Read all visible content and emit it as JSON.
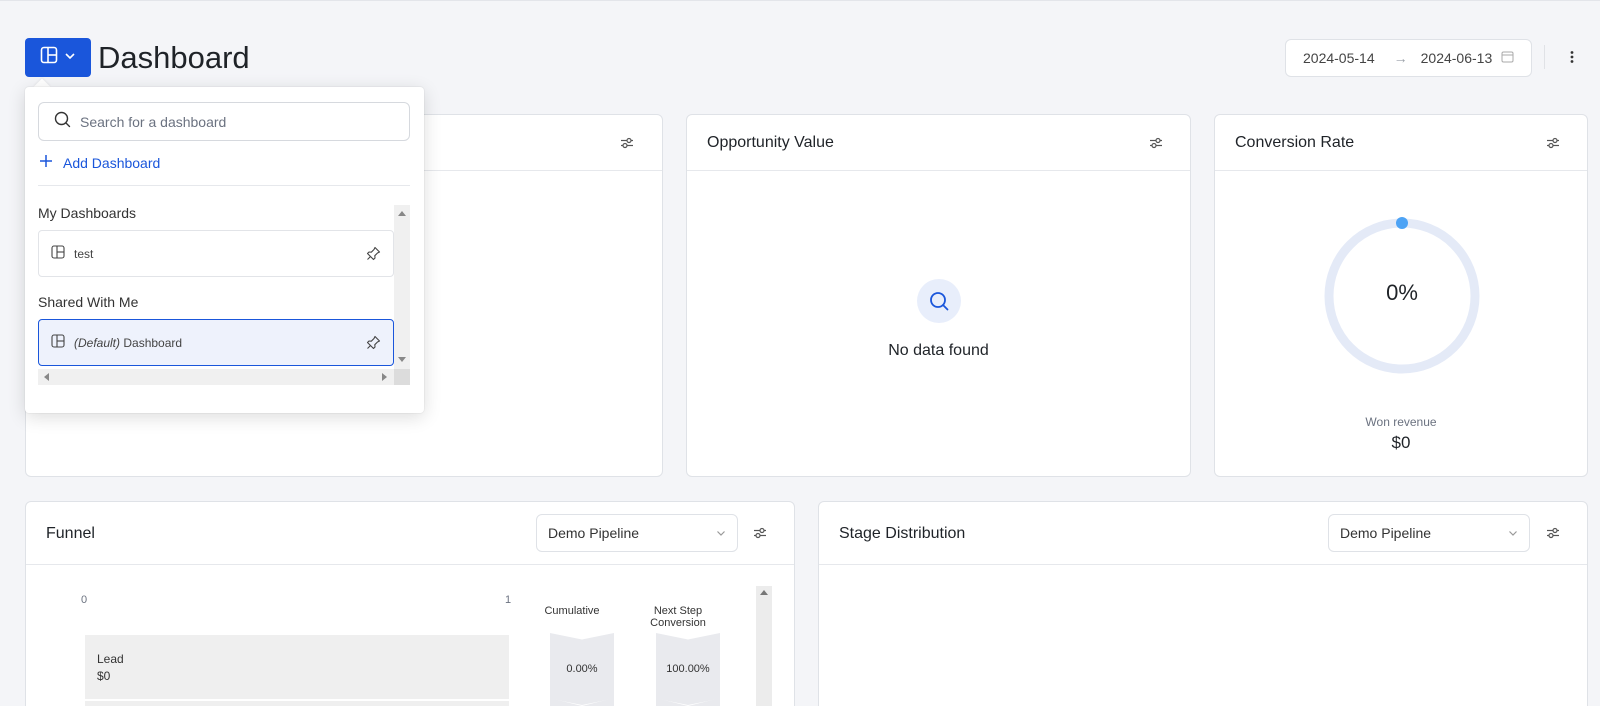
{
  "header": {
    "title": "Dashboard",
    "date_start": "2024-05-14",
    "date_end": "2024-06-13",
    "accent_color": "#1a56db"
  },
  "dropdown": {
    "search_placeholder": "Search for a dashboard",
    "add_label": "Add Dashboard",
    "my_dashboards_title": "My Dashboards",
    "my_dashboards": [
      {
        "name": "test"
      }
    ],
    "shared_title": "Shared With Me",
    "shared": [
      {
        "prefix": "(Default)",
        "name": "Dashboard",
        "selected": true
      }
    ]
  },
  "cards": {
    "opportunity": {
      "title": "Opportunity Value",
      "empty_text": "No data found"
    },
    "conversion": {
      "title": "Conversion Rate",
      "value": "0%",
      "won_label": "Won revenue",
      "won_value": "$0",
      "progress": 0
    },
    "funnel": {
      "title": "Funnel",
      "pipeline": "Demo Pipeline",
      "axis_min": "0",
      "axis_max": "1",
      "col_cumulative": "Cumulative",
      "col_next_line1": "Next Step",
      "col_next_line2": "Conversion",
      "stages": [
        {
          "name": "Lead",
          "value": "$0",
          "cumulative": "0.00%",
          "next_step": "100.00%"
        }
      ]
    },
    "stage_distribution": {
      "title": "Stage Distribution",
      "pipeline": "Demo Pipeline"
    }
  },
  "icons": {
    "dashboard_button": "layout-icon",
    "filter": "sliders-icon",
    "search": "search-icon",
    "pin": "pin-icon",
    "calendar": "calendar-icon",
    "more": "kebab-icon"
  }
}
